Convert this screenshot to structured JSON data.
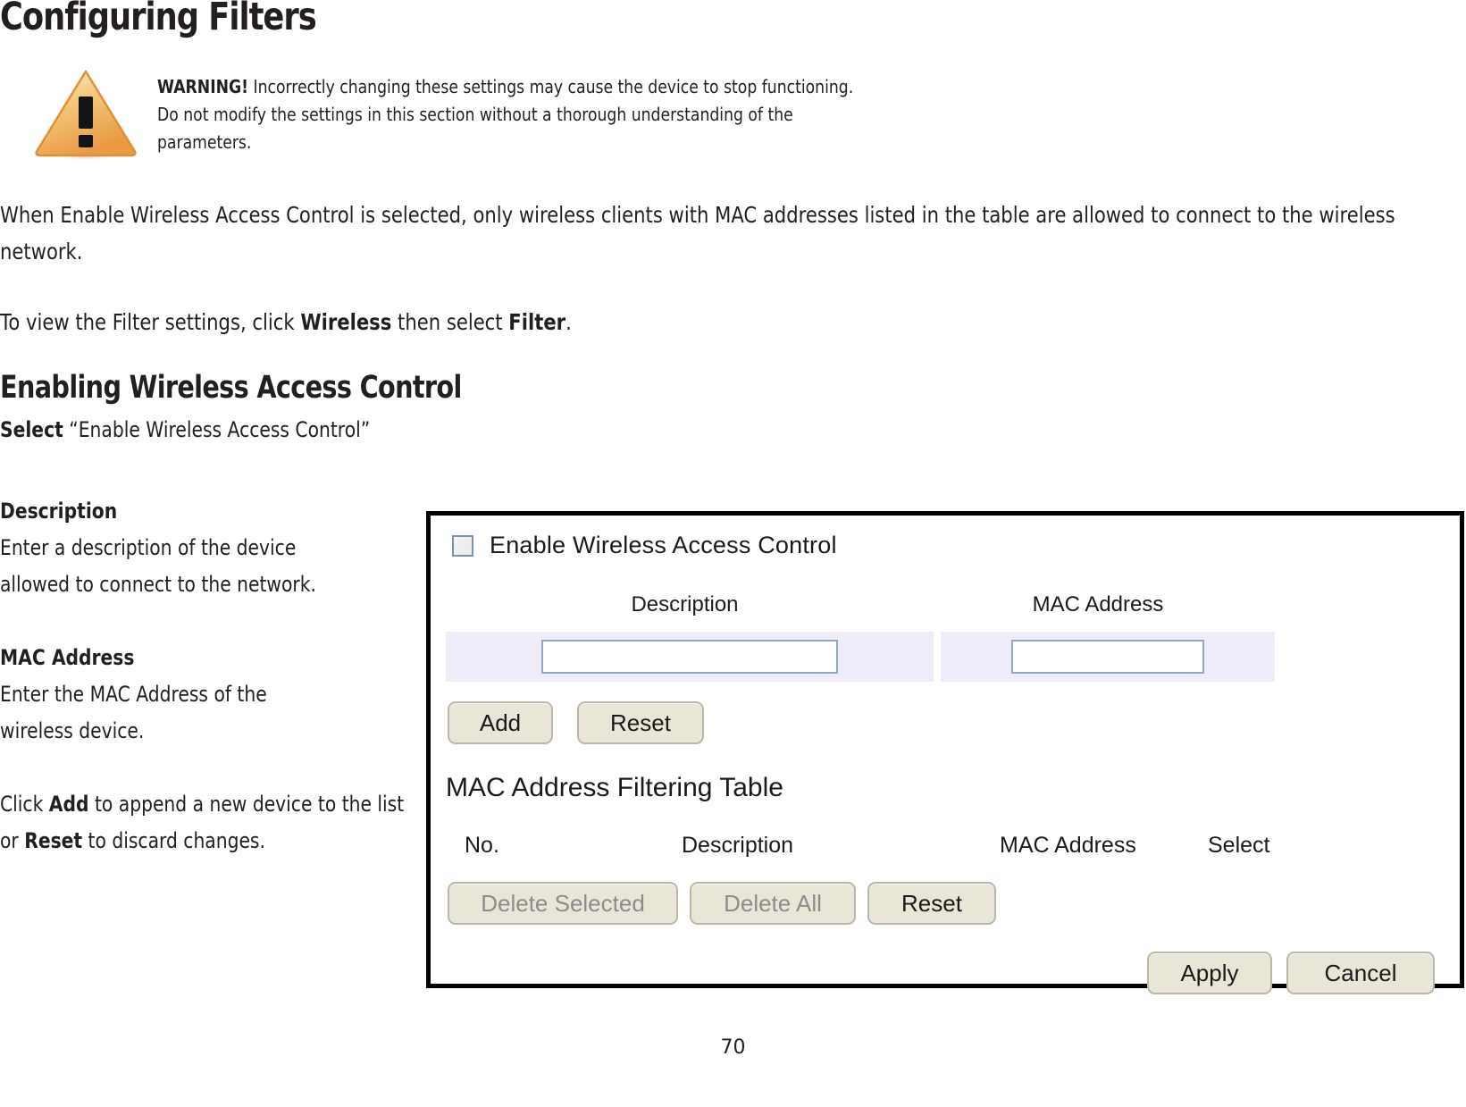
{
  "document": {
    "title": "Configuring Filters",
    "page_number": "70"
  },
  "warning": {
    "icon": "warning-triangle-icon",
    "label": "WARNING!",
    "text": " Incorrectly changing these settings may cause the device to stop functioning. Do not modify the settings in this section without a thorough understanding of the parameters."
  },
  "body": {
    "intro": "When Enable Wireless Access Control is selected, only wireless clients with MAC addresses listed in the table are allowed to connect to the wireless network.",
    "filter_nav_prefix": "To view the Filter settings, click ",
    "filter_nav_bold1": "Wireless",
    "filter_nav_middle": " then select ",
    "filter_nav_bold2": "Filter",
    "filter_nav_suffix": "."
  },
  "section": {
    "heading": "Enabling Wireless Access Control",
    "select_bold": "Select",
    "select_rest": " “Enable Wireless Access Control”"
  },
  "left_column": {
    "description_label": "Description",
    "description_line1": "Enter a description of the device",
    "description_line2": "allowed to connect to the network.",
    "mac_label": "MAC Address",
    "mac_line1": "Enter the MAC Address of the",
    "mac_line2": "wireless device.",
    "add_line_prefix": "Click ",
    "add_line_bold1": "Add",
    "add_line_middle": " to append a new device to the list or ",
    "add_line_bold2": "Reset",
    "add_line_suffix": " to discard changes."
  },
  "ui_panel": {
    "enable_checkbox_label": "Enable Wireless Access Control",
    "enable_checkbox_checked": false,
    "field_header_description": "Description",
    "field_header_mac": "MAC Address",
    "description_input_value": "",
    "mac_input_value": "",
    "buttons": {
      "add": "Add",
      "reset": "Reset",
      "delete_selected": "Delete Selected",
      "delete_all": "Delete All",
      "reset2": "Reset",
      "apply": "Apply",
      "cancel": "Cancel"
    },
    "table": {
      "title": "MAC Address Filtering Table",
      "columns": [
        "No.",
        "Description",
        "MAC Address",
        "Select"
      ],
      "rows": []
    },
    "colors": {
      "button_face": "#e9e6d8",
      "button_border": "#b9b7aa",
      "input_border": "#8fa9c4",
      "row_background": "#f1ecf9",
      "panel_border": "#000000"
    }
  }
}
